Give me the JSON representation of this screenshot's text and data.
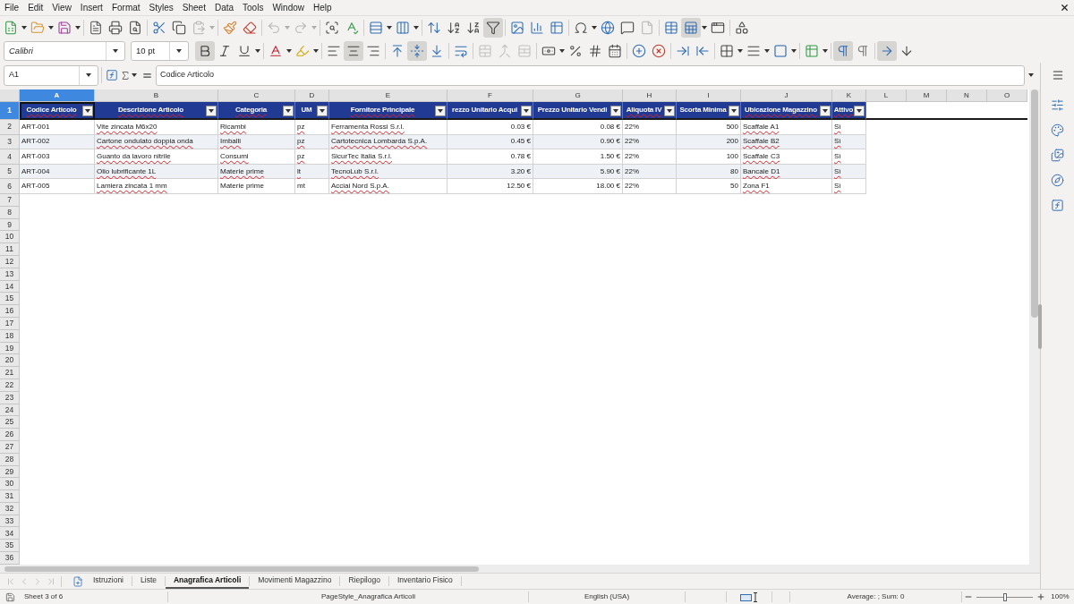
{
  "menu_bar": [
    "File",
    "Edit",
    "View",
    "Insert",
    "Format",
    "Styles",
    "Sheet",
    "Data",
    "Tools",
    "Window",
    "Help"
  ],
  "standard_toolbar": [
    {
      "pressed": false,
      "disabled": false
    },
    {
      "pressed": false,
      "disabled": false
    },
    {
      "pressed": false,
      "disabled": false
    },
    {
      "pressed": false,
      "disabled": false
    },
    {
      "pressed": false,
      "disabled": false
    },
    {
      "pressed": false,
      "disabled": false
    },
    {
      "pressed": false,
      "disabled": false
    },
    {
      "pressed": false,
      "disabled": false
    },
    {
      "pressed": false,
      "disabled": true
    },
    {
      "pressed": false,
      "disabled": false
    },
    {
      "pressed": false,
      "disabled": false
    },
    {
      "pressed": false,
      "disabled": true
    },
    {
      "pressed": false,
      "disabled": true
    },
    {
      "pressed": false,
      "disabled": false
    },
    {
      "pressed": false,
      "disabled": false
    },
    {
      "pressed": false,
      "disabled": false
    },
    {
      "pressed": false,
      "disabled": false
    },
    {
      "pressed": false,
      "disabled": false
    },
    {
      "pressed": false,
      "disabled": false
    },
    {
      "pressed": false,
      "disabled": false
    },
    {
      "pressed": true,
      "disabled": false
    },
    {
      "pressed": false,
      "disabled": false
    },
    {
      "pressed": false,
      "disabled": false
    },
    {
      "pressed": false,
      "disabled": false
    },
    {
      "pressed": false,
      "disabled": false
    },
    {
      "pressed": false,
      "disabled": false
    },
    {
      "pressed": false,
      "disabled": false
    },
    {
      "pressed": false,
      "disabled": true
    },
    {
      "pressed": false,
      "disabled": false
    },
    {
      "pressed": true,
      "disabled": false
    },
    {
      "pressed": false,
      "disabled": false
    },
    {
      "pressed": false,
      "disabled": false
    }
  ],
  "formatting_toolbar": {
    "font_name": "Calibri",
    "font_size": "10 pt",
    "buttons": [
      {
        "pressed": true,
        "disabled": false
      },
      {
        "pressed": false,
        "disabled": false
      },
      {
        "pressed": false,
        "disabled": false
      },
      {
        "pressed": false,
        "disabled": false
      },
      {
        "pressed": false,
        "disabled": false
      },
      {
        "pressed": false,
        "disabled": false
      },
      {
        "pressed": true,
        "disabled": false
      },
      {
        "pressed": false,
        "disabled": false
      },
      {
        "pressed": false,
        "disabled": false
      },
      {
        "pressed": true,
        "disabled": false
      },
      {
        "pressed": false,
        "disabled": false
      },
      {
        "pressed": false,
        "disabled": false
      },
      {
        "pressed": false,
        "disabled": true
      },
      {
        "pressed": false,
        "disabled": true
      },
      {
        "pressed": false,
        "disabled": true
      },
      {
        "pressed": false,
        "disabled": false
      },
      {
        "pressed": false,
        "disabled": false
      },
      {
        "pressed": false,
        "disabled": false
      },
      {
        "pressed": false,
        "disabled": false
      },
      {
        "pressed": false,
        "disabled": false
      },
      {
        "pressed": false,
        "disabled": false
      },
      {
        "pressed": false,
        "disabled": false
      },
      {
        "pressed": false,
        "disabled": false
      },
      {
        "pressed": false,
        "disabled": false
      },
      {
        "pressed": false,
        "disabled": false
      },
      {
        "pressed": false,
        "disabled": false
      },
      {
        "pressed": false,
        "disabled": false
      },
      {
        "pressed": true,
        "disabled": false
      },
      {
        "pressed": false,
        "disabled": false
      },
      {
        "pressed": true,
        "disabled": false
      },
      {
        "pressed": false,
        "disabled": false
      }
    ]
  },
  "formula_bar": {
    "cell_reference": "A1",
    "content": "Codice Articolo"
  },
  "sheet": {
    "column_headers": [
      {
        "label": "A",
        "selected": true
      },
      {
        "label": "B",
        "selected": false
      },
      {
        "label": "C",
        "selected": false
      },
      {
        "label": "D",
        "selected": false
      },
      {
        "label": "E",
        "selected": false
      },
      {
        "label": "F",
        "selected": false
      },
      {
        "label": "G",
        "selected": false
      },
      {
        "label": "H",
        "selected": false
      },
      {
        "label": "I",
        "selected": false
      },
      {
        "label": "J",
        "selected": false
      },
      {
        "label": "K",
        "selected": false
      },
      {
        "label": "L",
        "selected": false
      },
      {
        "label": "M",
        "selected": false
      },
      {
        "label": "N",
        "selected": false
      },
      {
        "label": "O",
        "selected": false
      }
    ],
    "row_headers": [
      {
        "label": "1",
        "selected": true
      },
      {
        "label": "2",
        "selected": false
      },
      {
        "label": "3",
        "selected": false
      },
      {
        "label": "4",
        "selected": false
      },
      {
        "label": "5",
        "selected": false
      },
      {
        "label": "6",
        "selected": false
      },
      {
        "label": "7",
        "selected": false
      },
      {
        "label": "8",
        "selected": false
      },
      {
        "label": "9",
        "selected": false
      },
      {
        "label": "10",
        "selected": false
      },
      {
        "label": "11",
        "selected": false
      },
      {
        "label": "12",
        "selected": false
      },
      {
        "label": "13",
        "selected": false
      },
      {
        "label": "14",
        "selected": false
      },
      {
        "label": "15",
        "selected": false
      },
      {
        "label": "16",
        "selected": false
      },
      {
        "label": "17",
        "selected": false
      },
      {
        "label": "18",
        "selected": false
      },
      {
        "label": "19",
        "selected": false
      },
      {
        "label": "20",
        "selected": false
      },
      {
        "label": "21",
        "selected": false
      },
      {
        "label": "22",
        "selected": false
      },
      {
        "label": "23",
        "selected": false
      },
      {
        "label": "24",
        "selected": false
      },
      {
        "label": "25",
        "selected": false
      },
      {
        "label": "26",
        "selected": false
      },
      {
        "label": "27",
        "selected": false
      },
      {
        "label": "28",
        "selected": false
      },
      {
        "label": "29",
        "selected": false
      },
      {
        "label": "30",
        "selected": false
      },
      {
        "label": "31",
        "selected": false
      },
      {
        "label": "32",
        "selected": false
      },
      {
        "label": "33",
        "selected": false
      },
      {
        "label": "34",
        "selected": false
      },
      {
        "label": "35",
        "selected": false
      },
      {
        "label": "36",
        "selected": false
      }
    ],
    "table": {
      "columns": [
        {
          "title": "Codice Articolo",
          "flagged": true
        },
        {
          "title": "Descrizione Articolo",
          "flagged": true
        },
        {
          "title": "Categoria",
          "flagged": true
        },
        {
          "title": "UM",
          "flagged": false
        },
        {
          "title": "Fornitore Principale",
          "flagged": true
        },
        {
          "title": "rezzo Unitario Acqui",
          "flagged": false
        },
        {
          "title": "Prezzo Unitario Vendi",
          "flagged": false
        },
        {
          "title": "Aliquota IV",
          "flagged": true
        },
        {
          "title": "Scorta Minima",
          "flagged": false
        },
        {
          "title": "Ubicazione Magazzino",
          "flagged": true
        },
        {
          "title": "Attivo",
          "flagged": true
        }
      ],
      "rows": [
        {
          "cells": [
            {
              "text": "ART-001",
              "flagged": false
            },
            {
              "text": "Vite zincata M6x20",
              "flagged": true
            },
            {
              "text": "Ricambi",
              "flagged": true
            },
            {
              "text": "pz",
              "flagged": true
            },
            {
              "text": "Ferramenta Rossi S.r.l.",
              "flagged": true
            },
            {
              "text": "0.03 €",
              "flagged": false
            },
            {
              "text": "0.08 €",
              "flagged": false
            },
            {
              "text": "22%",
              "flagged": false
            },
            {
              "text": "500",
              "flagged": false
            },
            {
              "text": "Scaffale A1",
              "flagged": true
            },
            {
              "text": "Sì",
              "flagged": true
            }
          ]
        },
        {
          "cells": [
            {
              "text": "ART-002",
              "flagged": false
            },
            {
              "text": "Cartone ondulato doppia onda",
              "flagged": true
            },
            {
              "text": "Imballi",
              "flagged": true
            },
            {
              "text": "pz",
              "flagged": true
            },
            {
              "text": "Cartotecnica Lombarda S.p.A.",
              "flagged": true
            },
            {
              "text": "0.45 €",
              "flagged": false
            },
            {
              "text": "0.90 €",
              "flagged": false
            },
            {
              "text": "22%",
              "flagged": false
            },
            {
              "text": "200",
              "flagged": false
            },
            {
              "text": "Scaffale B2",
              "flagged": true
            },
            {
              "text": "Sì",
              "flagged": true
            }
          ]
        },
        {
          "cells": [
            {
              "text": "ART-003",
              "flagged": false
            },
            {
              "text": "Guanto da lavoro nitrile",
              "flagged": true
            },
            {
              "text": "Consumi",
              "flagged": true
            },
            {
              "text": "pz",
              "flagged": true
            },
            {
              "text": "SicurTec Italia S.r.l.",
              "flagged": true
            },
            {
              "text": "0.78 €",
              "flagged": false
            },
            {
              "text": "1.50 €",
              "flagged": false
            },
            {
              "text": "22%",
              "flagged": false
            },
            {
              "text": "100",
              "flagged": false
            },
            {
              "text": "Scaffale C3",
              "flagged": true
            },
            {
              "text": "Sì",
              "flagged": true
            }
          ]
        },
        {
          "cells": [
            {
              "text": "ART-004",
              "flagged": false
            },
            {
              "text": "Olio lubrificante 1L",
              "flagged": true
            },
            {
              "text": "Materie prime",
              "flagged": true
            },
            {
              "text": "lt",
              "flagged": true
            },
            {
              "text": "TecnoLub S.r.l.",
              "flagged": true
            },
            {
              "text": "3.20 €",
              "flagged": false
            },
            {
              "text": "5.90 €",
              "flagged": false
            },
            {
              "text": "22%",
              "flagged": false
            },
            {
              "text": "80",
              "flagged": false
            },
            {
              "text": "Bancale D1",
              "flagged": true
            },
            {
              "text": "Sì",
              "flagged": true
            }
          ]
        },
        {
          "cells": [
            {
              "text": "ART-005",
              "flagged": false
            },
            {
              "text": "Lamiera zincata 1 mm",
              "flagged": true
            },
            {
              "text": "Materie prime",
              "flagged": false
            },
            {
              "text": "mt",
              "flagged": false
            },
            {
              "text": "Acciai Nord S.p.A.",
              "flagged": true
            },
            {
              "text": "12.50 €",
              "flagged": false
            },
            {
              "text": "18.00 €",
              "flagged": false
            },
            {
              "text": "22%",
              "flagged": false
            },
            {
              "text": "50",
              "flagged": false
            },
            {
              "text": "Zona F1",
              "flagged": true
            },
            {
              "text": "Sì",
              "flagged": true
            }
          ]
        }
      ]
    }
  },
  "tab_navigation": [
    {
      "disabled": true
    },
    {
      "disabled": true
    },
    {
      "disabled": true
    },
    {
      "disabled": true
    }
  ],
  "sheet_tabs": [
    {
      "label": "Istruzioni",
      "selected": false
    },
    {
      "label": "Liste",
      "selected": false
    },
    {
      "label": "Anagrafica Articoli",
      "selected": true
    },
    {
      "label": "Movimenti Magazzino",
      "selected": false
    },
    {
      "label": "Riepilogo",
      "selected": false
    },
    {
      "label": "Inventario Fisico",
      "selected": false
    }
  ],
  "status_bar": {
    "sheet_position": "Sheet 3 of 6",
    "page_style": "PageStyle_Anagrafica Articoli",
    "language": "English (USA)",
    "selection_summary": "Average: ; Sum: 0",
    "zoom": {
      "level": 0.5,
      "reading": "100%"
    }
  }
}
